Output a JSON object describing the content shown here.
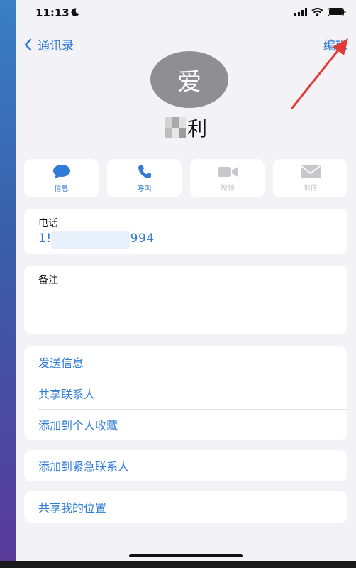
{
  "status_bar": {
    "time": "11:13"
  },
  "nav": {
    "back_label": "通讯录",
    "edit_label": "编辑"
  },
  "contact": {
    "avatar_text": "爱",
    "name_visible": "利"
  },
  "actions": [
    {
      "label": "信息",
      "icon": "message-icon",
      "enabled": true
    },
    {
      "label": "呼叫",
      "icon": "phone-icon",
      "enabled": true
    },
    {
      "label": "视频",
      "icon": "video-icon",
      "enabled": false
    },
    {
      "label": "邮件",
      "icon": "mail-icon",
      "enabled": false
    }
  ],
  "phone": {
    "label": "电话",
    "number_prefix": "1!",
    "number_suffix": "994"
  },
  "notes": {
    "label": "备注"
  },
  "list_group_1": [
    "发送信息",
    "共享联系人",
    "添加到个人收藏"
  ],
  "list_group_2": [
    "添加到紧急联系人"
  ],
  "list_group_3": [
    "共享我的位置"
  ],
  "colors": {
    "accent": "#2f7bd6",
    "annotation_arrow": "#e53935",
    "avatar_bg": "#8e8e93"
  }
}
